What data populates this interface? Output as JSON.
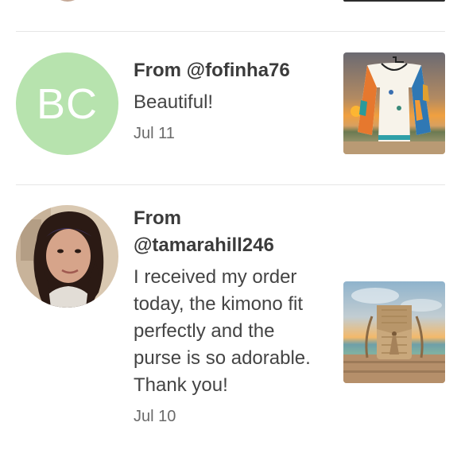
{
  "comments": [
    {
      "avatar_type": "initials",
      "initials": "BC",
      "avatar_color": "#b7e3ae",
      "from_label": "From @fofinha76",
      "message": "Beautiful!",
      "date": "Jul 11",
      "thumbnail_icon": "kimono-top-product-image"
    },
    {
      "avatar_type": "photo",
      "avatar_icon": "user-profile-photo",
      "from_label": "From @tamarahill246",
      "message": "I received my order today, the kimono fit perfectly and the purse is so adorable. Thank you!",
      "date": "Jul 10",
      "thumbnail_icon": "crossbody-purse-product-image"
    }
  ]
}
